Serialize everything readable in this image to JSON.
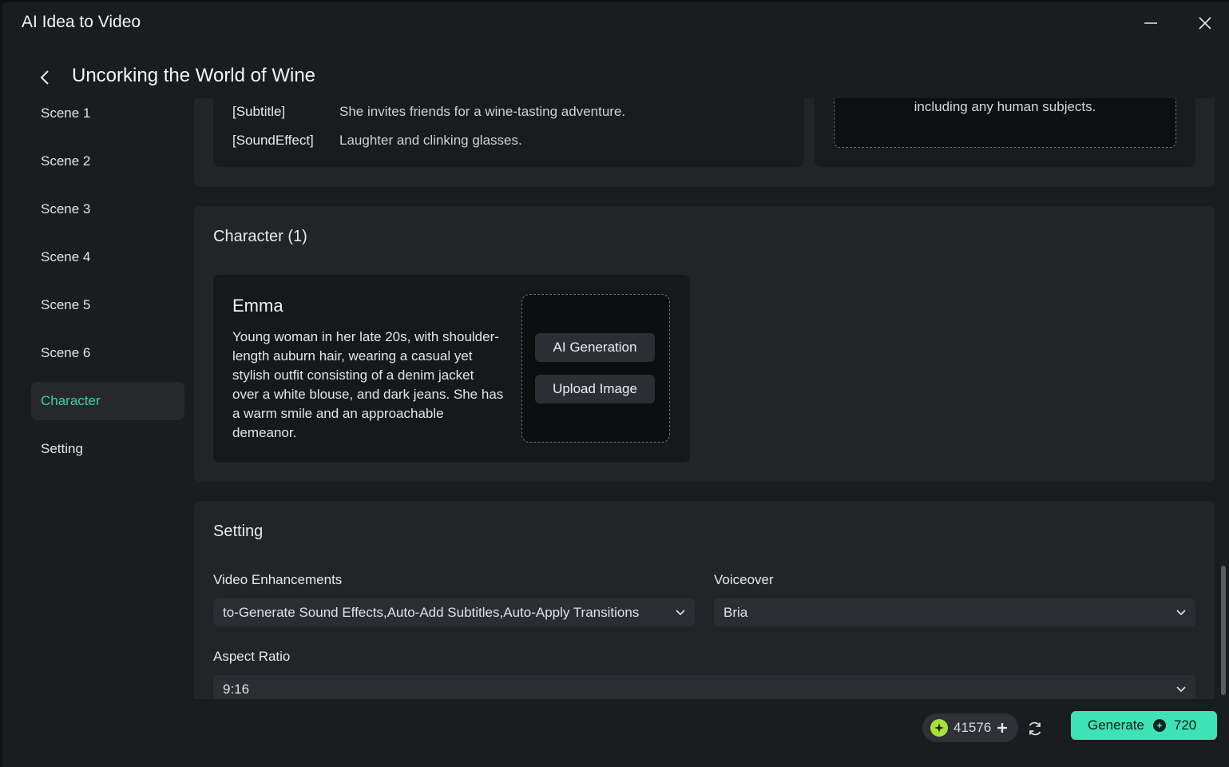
{
  "window": {
    "title": "AI Idea to Video"
  },
  "header": {
    "title": "Uncorking the World of Wine"
  },
  "sidebar": {
    "items": [
      {
        "label": "Scene 1",
        "active": false
      },
      {
        "label": "Scene 2",
        "active": false
      },
      {
        "label": "Scene 3",
        "active": false
      },
      {
        "label": "Scene 4",
        "active": false
      },
      {
        "label": "Scene 5",
        "active": false
      },
      {
        "label": "Scene 6",
        "active": false
      },
      {
        "label": "Character",
        "active": true
      },
      {
        "label": "Setting",
        "active": false
      }
    ]
  },
  "scene": {
    "subtitle_tag": "[Subtitle]",
    "subtitle_text": "She invites friends for a wine-tasting adventure.",
    "soundeffect_tag": "[SoundEffect]",
    "soundeffect_text": "Laughter and clinking glasses.",
    "image_note": "including any human subjects."
  },
  "character_section": {
    "title": "Character (1)",
    "character": {
      "name": "Emma",
      "description": "Young woman in her late 20s, with shoulder-length auburn hair, wearing a casual yet stylish outfit consisting of a denim jacket over a white blouse, and dark jeans. She has a warm smile and an approachable demeanor.",
      "ai_generation_label": "AI Generation",
      "upload_image_label": "Upload Image"
    }
  },
  "setting_section": {
    "title": "Setting",
    "video_enhancements_label": "Video Enhancements",
    "video_enhancements_value": "to-Generate Sound Effects,Auto-Add Subtitles,Auto-Apply Transitions",
    "voiceover_label": "Voiceover",
    "voiceover_value": "Bria",
    "aspect_ratio_label": "Aspect Ratio",
    "aspect_ratio_value": "9:16"
  },
  "footer": {
    "credits": "41576",
    "generate_label": "Generate",
    "generate_cost": "720"
  },
  "colors": {
    "accent": "#3ee3b5",
    "active_nav": "#35d3ac",
    "coin": "#a8e03a"
  }
}
